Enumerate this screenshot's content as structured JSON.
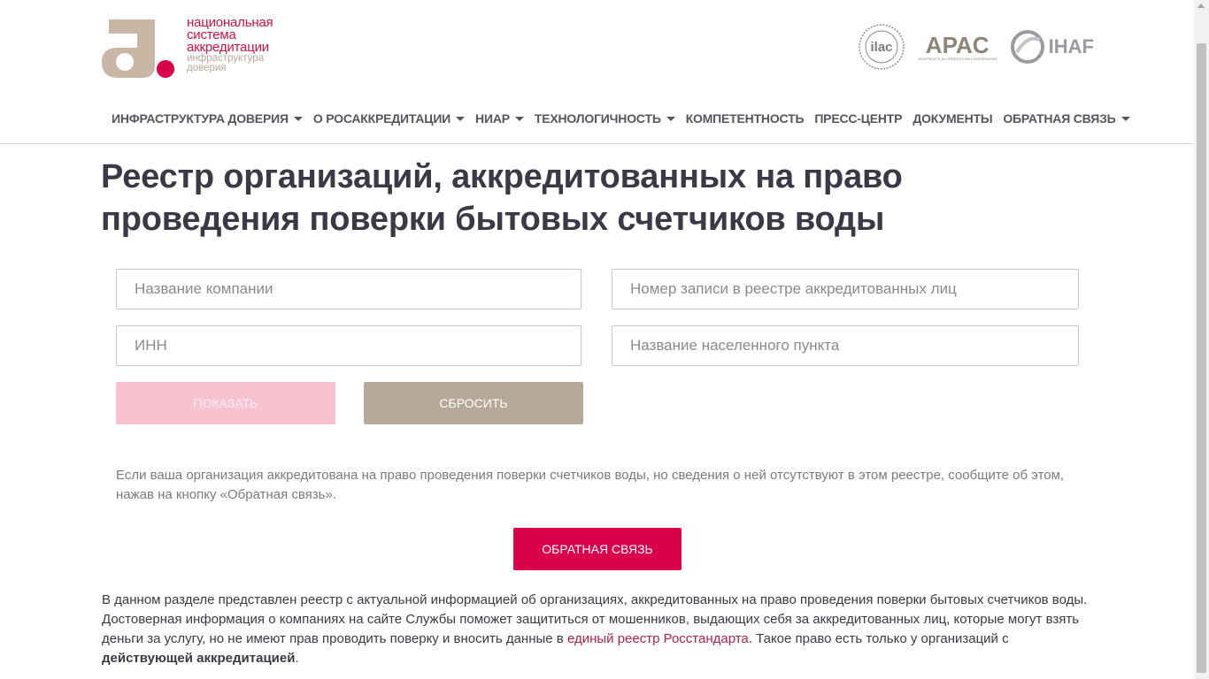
{
  "header": {
    "logo_lines": [
      "национальная",
      "система",
      "аккредитации"
    ],
    "logo_sub": [
      "инфраструктура",
      "доверия"
    ],
    "partners": {
      "ilac": "ilac",
      "apac": "APAC",
      "apac_sub": "ASIA PACIFIC ACCREDITATION COOPERATION",
      "ihaf": "IHAF"
    }
  },
  "nav": [
    {
      "label": "ИНФРАСТРУКТУРА ДОВЕРИЯ",
      "dropdown": true
    },
    {
      "label": "О РОСАККРЕДИТАЦИИ",
      "dropdown": true
    },
    {
      "label": "НИАР",
      "dropdown": true
    },
    {
      "label": "ТЕХНОЛОГИЧНОСТЬ",
      "dropdown": true
    },
    {
      "label": "КОМПЕТЕНТНОСТЬ",
      "dropdown": false
    },
    {
      "label": "ПРЕСС-ЦЕНТР",
      "dropdown": false
    },
    {
      "label": "ДОКУМЕНТЫ",
      "dropdown": false
    },
    {
      "label": "ОБРАТНАЯ СВЯЗЬ",
      "dropdown": true
    }
  ],
  "main": {
    "title": "Реестр организаций, аккредитованных на право проведения поверки бытовых счетчиков воды",
    "form": {
      "company_placeholder": "Название компании",
      "record_number_placeholder": "Номер записи в реестре аккредитованных лиц",
      "inn_placeholder": "ИНН",
      "city_placeholder": "Название населенного пункта",
      "show_label": "ПОКАЗАТЬ",
      "reset_label": "СБРОСИТЬ"
    },
    "notice": "Если ваша организация аккредитована на право проведения поверки счетчиков воды, но сведения о ней отсутствуют в этом реестре, сообщите об этом, нажав на кнопку «Обратная связь».",
    "feedback_button": "ОБРАТНАЯ СВЯЗЬ",
    "description": {
      "part1": "В данном разделе представлен реестр с актуальной информацией об организациях, аккредитованных на право проведения поверки бытовых счетчиков воды. Достоверная информация о компаниях на сайте Службы поможет защититься от мошенников, выдающих себя за аккредитованных лиц, которые могут взять деньги за услугу, но не имеют прав проводить поверку и вносить данные в ",
      "link": "единый реестр Росстандарта",
      "part2": ". Такое право есть только у организаций с ",
      "bold": "действующей аккредитацией",
      "part3": "."
    }
  },
  "colors": {
    "accent": "#d9004c",
    "accent_light": "#f7c3d0",
    "beige": "#b6a999",
    "text": "#3a3a46"
  }
}
